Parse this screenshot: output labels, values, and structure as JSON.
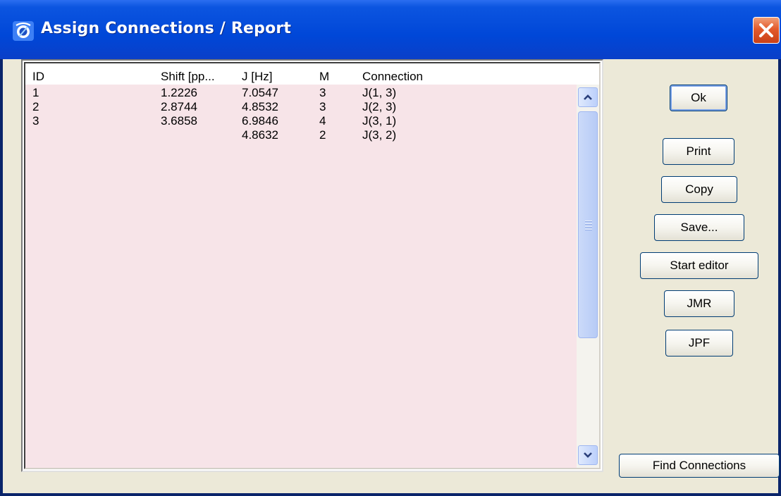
{
  "window": {
    "title": "Assign Connections / Report",
    "close_icon": "close-icon",
    "app_icon": "app-icon"
  },
  "table": {
    "columns": [
      "ID",
      "Shift [pp...",
      "J [Hz]",
      "M",
      "Connection"
    ],
    "rows": [
      {
        "id": "1",
        "shift": "1.2226",
        "j": "7.0547",
        "m": "3",
        "connection": "J(1, 3)"
      },
      {
        "id": "2",
        "shift": "2.8744",
        "j": "4.8532",
        "m": "3",
        "connection": "J(2, 3)"
      },
      {
        "id": "3",
        "shift": "3.6858",
        "j": "6.9846",
        "m": "4",
        "connection": "J(3, 1)"
      },
      {
        "id": "",
        "shift": "",
        "j": "4.8632",
        "m": "2",
        "connection": "J(3, 2)"
      }
    ]
  },
  "buttons": {
    "ok": "Ok",
    "print": "Print",
    "copy": "Copy",
    "save": "Save...",
    "start_editor": "Start editor",
    "jmr": "JMR",
    "jpf": "JPF",
    "find_connections": "Find Connections"
  },
  "colors": {
    "titlebar": "#0047d8",
    "table_background": "#f7e4e8",
    "window_background": "#ece9d8"
  }
}
